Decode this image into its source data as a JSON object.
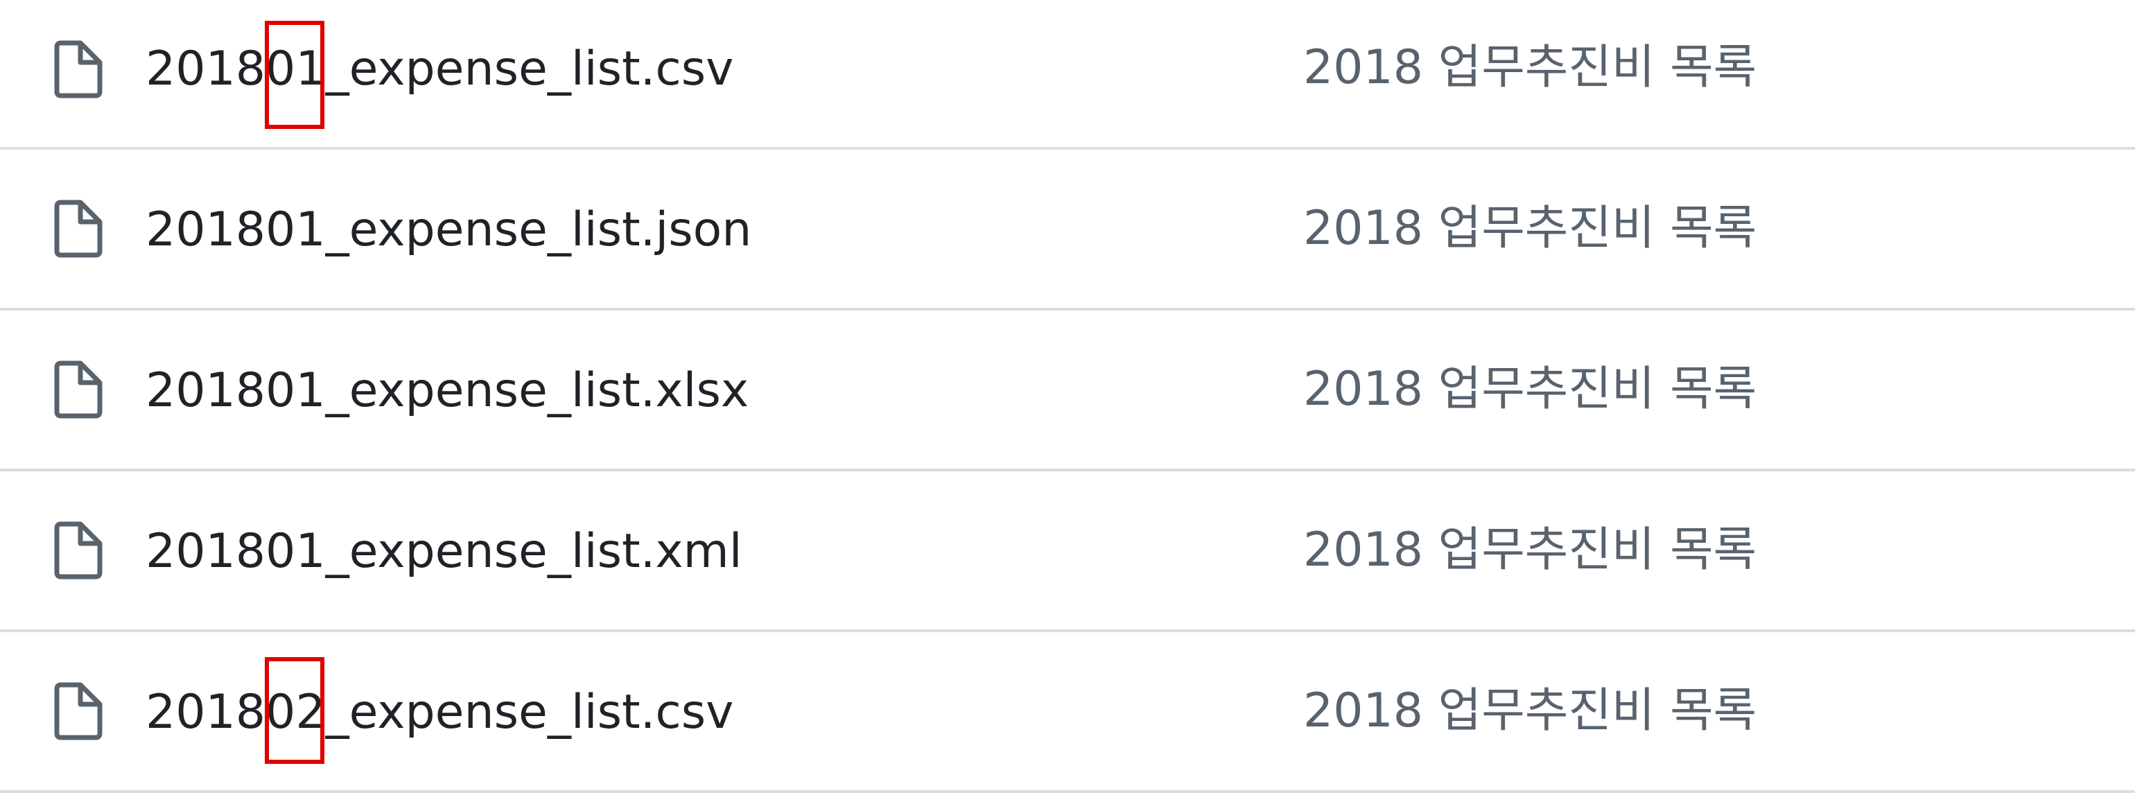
{
  "files": [
    {
      "name": "201801_expense_list.csv",
      "icon": "file-icon",
      "message": "2018 업무추진비 목록"
    },
    {
      "name": "201801_expense_list.json",
      "icon": "file-icon",
      "message": "2018 업무추진비 목록"
    },
    {
      "name": "201801_expense_list.xlsx",
      "icon": "file-icon",
      "message": "2018 업무추진비 목록"
    },
    {
      "name": "201801_expense_list.xml",
      "icon": "file-icon",
      "message": "2018 업무추진비 목록"
    },
    {
      "name": "201802_expense_list.csv",
      "icon": "file-icon",
      "message": "2018 업무추진비 목록"
    }
  ],
  "colors": {
    "file_name": "#1f2328",
    "commit_message": "#59636e",
    "icon": "#59636e",
    "divider": "#d8dee4",
    "highlight": "#e00000"
  }
}
